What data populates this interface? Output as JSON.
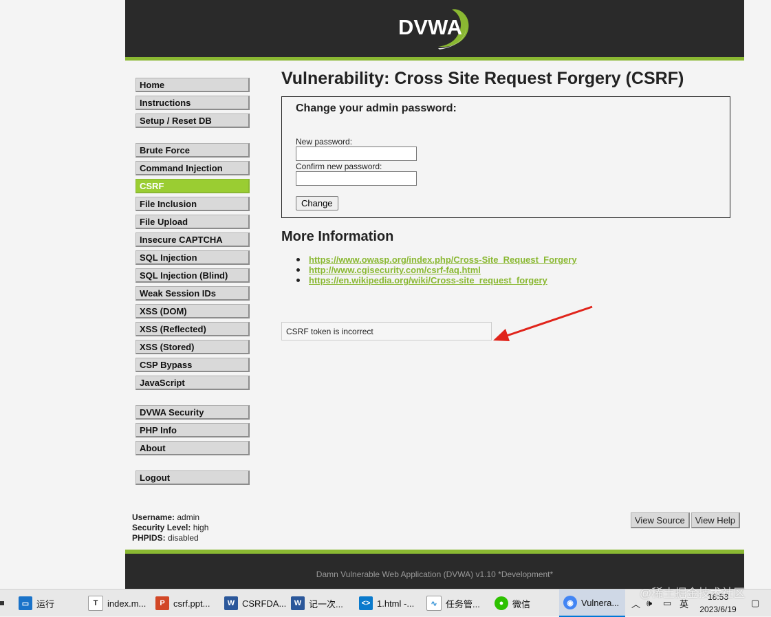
{
  "logo_text": "DVWA",
  "menu": {
    "group1": [
      "Home",
      "Instructions",
      "Setup / Reset DB"
    ],
    "group2": [
      "Brute Force",
      "Command Injection",
      "CSRF",
      "File Inclusion",
      "File Upload",
      "Insecure CAPTCHA",
      "SQL Injection",
      "SQL Injection (Blind)",
      "Weak Session IDs",
      "XSS (DOM)",
      "XSS (Reflected)",
      "XSS (Stored)",
      "CSP Bypass",
      "JavaScript"
    ],
    "group3": [
      "DVWA Security",
      "PHP Info",
      "About"
    ],
    "group4": [
      "Logout"
    ],
    "active": "CSRF"
  },
  "main": {
    "title": "Vulnerability: Cross Site Request Forgery (CSRF)",
    "form_title": "Change your admin password:",
    "new_password_label": "New password:",
    "confirm_password_label": "Confirm new password:",
    "new_password_value": "",
    "confirm_password_value": "",
    "change_button": "Change",
    "more_info_title": "More Information",
    "links": [
      "https://www.owasp.org/index.php/Cross-Site_Request_Forgery",
      "http://www.cgisecurity.com/csrf-faq.html",
      "https://en.wikipedia.org/wiki/Cross-site_request_forgery"
    ],
    "message": "CSRF token is incorrect"
  },
  "user_info": {
    "username_label": "Username:",
    "username": "admin",
    "security_label": "Security Level:",
    "security": "high",
    "phpids_label": "PHPIDS:",
    "phpids": "disabled"
  },
  "buttons": {
    "view_source": "View Source",
    "view_help": "View Help"
  },
  "footer": "Damn Vulnerable Web Application (DVWA) v1.10 *Development*",
  "taskbar": {
    "items": [
      "运行",
      "index.m...",
      "csrf.ppt...",
      "CSRFDA...",
      "记一次...",
      "1.html -...",
      "任务管...",
      "微信",
      "Vulnera..."
    ],
    "tray_lang": "英",
    "time": "18:53",
    "date": "2023/6/19"
  },
  "watermark": "@稀土掘金技术社区",
  "colors": {
    "accent": "#8ab832",
    "active_menu": "#9acd32",
    "header_bg": "#2a2a2a",
    "arrow": "#e0241b"
  }
}
